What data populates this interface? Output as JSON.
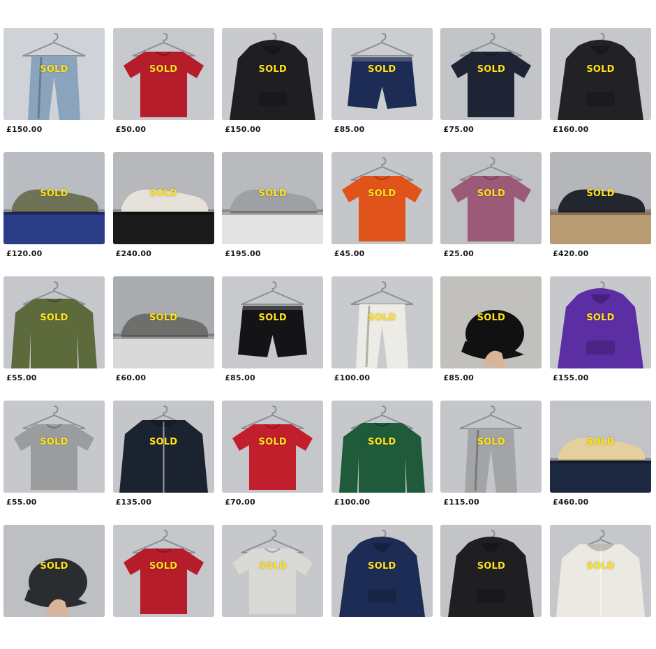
{
  "sold_label": "SOLD",
  "listings": [
    {
      "price": "£150.00",
      "kind": "trousers",
      "bg": "#cfd2d6",
      "color": "#8aa4bd"
    },
    {
      "price": "£50.00",
      "kind": "tshirt",
      "bg": "#c8c9cc",
      "color": "#b51d2a"
    },
    {
      "price": "£150.00",
      "kind": "hoodie",
      "bg": "#c9cacd",
      "color": "#1f1f22"
    },
    {
      "price": "£85.00",
      "kind": "shorts",
      "bg": "#cbcdd0",
      "color": "#1d2c55"
    },
    {
      "price": "£75.00",
      "kind": "tshirt",
      "bg": "#c3c4c7",
      "color": "#1e2433"
    },
    {
      "price": "£160.00",
      "kind": "hoodie",
      "bg": "#c6c7ca",
      "color": "#222224"
    },
    {
      "price": "£120.00",
      "kind": "shoebox",
      "bg": "#b9bcc0",
      "color": "#6e7358",
      "box": "#2b3d87"
    },
    {
      "price": "£240.00",
      "kind": "shoebox",
      "bg": "#b6b8bb",
      "color": "#e6e2da",
      "box": "#1b1b1c"
    },
    {
      "price": "£195.00",
      "kind": "shoebox",
      "bg": "#b8babd",
      "color": "#9da0a4",
      "box": "#e3e3e3"
    },
    {
      "price": "£45.00",
      "kind": "tshirt",
      "bg": "#c4c6c9",
      "color": "#e0541c"
    },
    {
      "price": "£25.00",
      "kind": "tshirt",
      "bg": "#c0c1c4",
      "color": "#9a5a78"
    },
    {
      "price": "£420.00",
      "kind": "shoebox",
      "bg": "#b4b6b9",
      "color": "#22262e",
      "box": "#b89a73"
    },
    {
      "price": "£55.00",
      "kind": "sweater",
      "bg": "#c5c7ca",
      "color": "#5d6a3c"
    },
    {
      "price": "£60.00",
      "kind": "shoebox",
      "bg": "#a9acaf",
      "color": "#6e6e6c",
      "box": "#d9d9d9"
    },
    {
      "price": "£85.00",
      "kind": "shorts",
      "bg": "#c8c9cc",
      "color": "#141416"
    },
    {
      "price": "£100.00",
      "kind": "trousers",
      "bg": "#c9cacd",
      "color": "#ecebe6"
    },
    {
      "price": "£85.00",
      "kind": "cap",
      "bg": "#c2c0bc",
      "color": "#111111"
    },
    {
      "price": "£155.00",
      "kind": "hoodie",
      "bg": "#c7c8cb",
      "color": "#5b2ea3"
    },
    {
      "price": "£55.00",
      "kind": "tshirt",
      "bg": "#c7c8cb",
      "color": "#9a9c9e"
    },
    {
      "price": "£135.00",
      "kind": "jacket",
      "bg": "#c4c6c9",
      "color": "#1c2330"
    },
    {
      "price": "£70.00",
      "kind": "tshirt",
      "bg": "#c6c7ca",
      "color": "#c21f2c"
    },
    {
      "price": "£100.00",
      "kind": "sweater",
      "bg": "#c6c8cb",
      "color": "#1f5a3b"
    },
    {
      "price": "£115.00",
      "kind": "trousers",
      "bg": "#c5c6c9",
      "color": "#a3a4a6"
    },
    {
      "price": "£460.00",
      "kind": "shoebox",
      "bg": "#c1c3c6",
      "color": "#e5cf9c",
      "box": "#1b2840"
    },
    {
      "price": "",
      "kind": "cap",
      "bg": "#bdbfc2",
      "color": "#2a2c30"
    },
    {
      "price": "",
      "kind": "tshirt",
      "bg": "#c6c7ca",
      "color": "#b51d2a"
    },
    {
      "price": "",
      "kind": "tshirt",
      "bg": "#c7c8cb",
      "color": "#d9d9d6"
    },
    {
      "price": "",
      "kind": "hoodie",
      "bg": "#c6c7ca",
      "color": "#1d2c55"
    },
    {
      "price": "",
      "kind": "hoodie",
      "bg": "#c3c4c7",
      "color": "#1f1f22"
    },
    {
      "price": "",
      "kind": "jacket",
      "bg": "#c6c7ca",
      "color": "#ece9e2"
    }
  ]
}
